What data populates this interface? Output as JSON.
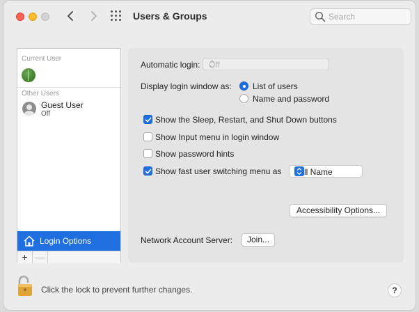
{
  "window": {
    "title": "Users & Groups",
    "search_placeholder": "Search"
  },
  "sidebar": {
    "current_user_label": "Current User",
    "other_users_label": "Other Users",
    "guest_user": {
      "name": "Guest User",
      "status": "Off"
    },
    "login_options_label": "Login Options",
    "add_symbol": "+",
    "remove_symbol": "—"
  },
  "main": {
    "automatic_login_label": "Automatic login:",
    "automatic_login_value": "Off",
    "display_login_label": "Display login window as:",
    "radio_list_of_users": "List of users",
    "radio_name_and_password": "Name and password",
    "display_login_selected": "List of users",
    "opt_sleep_restart": "Show the Sleep, Restart, and Shut Down buttons",
    "opt_input_menu": "Show Input menu in login window",
    "opt_password_hints": "Show password hints",
    "opt_fast_switching": "Show fast user switching menu as",
    "fast_switching_value": "Full Name",
    "accessibility_button": "Accessibility Options...",
    "network_server_label": "Network Account Server:",
    "join_button": "Join..."
  },
  "checkboxes": {
    "sleep_restart": true,
    "input_menu": false,
    "password_hints": false,
    "fast_switching": true
  },
  "footer": {
    "lock_text": "Click the lock to prevent further changes.",
    "help_label": "?"
  },
  "icons": [
    "back-chevron-icon",
    "forward-chevron-icon",
    "grid-icon",
    "search-icon",
    "home-icon",
    "lock-icon",
    "help-icon"
  ],
  "colors": {
    "accent": "#1f6fe0",
    "close": "#ff5f57",
    "minimize": "#febc2e"
  }
}
